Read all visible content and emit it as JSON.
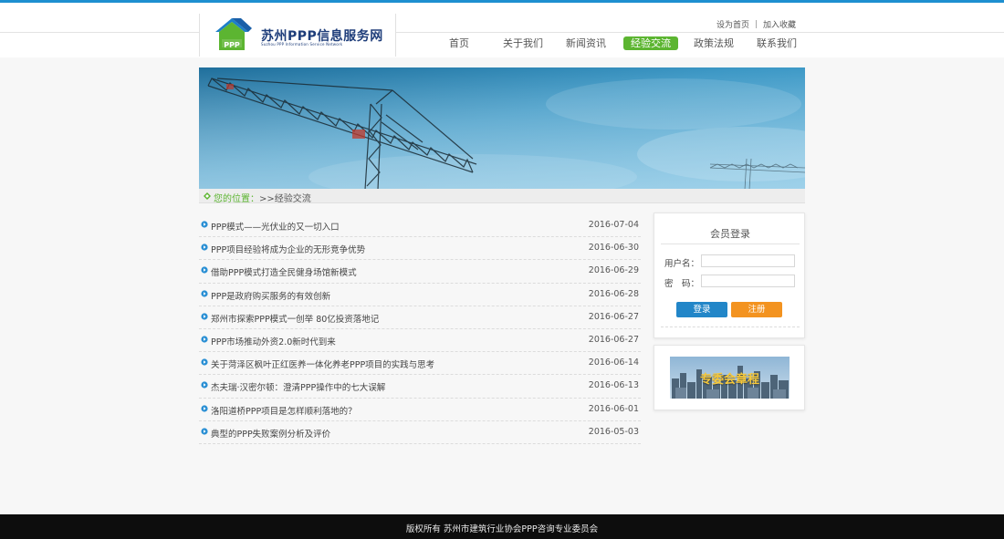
{
  "header": {
    "logo": {
      "title": "苏州PPP信息服务网",
      "subtitle": "Suzhou PPP Information Service Network",
      "badge": "PPP"
    },
    "toplinks": {
      "home": "设为首页",
      "favorite": "加入收藏"
    },
    "nav": [
      {
        "label": "首页",
        "active": false
      },
      {
        "label": "关于我们",
        "active": false
      },
      {
        "label": "新闻资讯",
        "active": false
      },
      {
        "label": "经验交流",
        "active": true
      },
      {
        "label": "政策法规",
        "active": false
      },
      {
        "label": "联系我们",
        "active": false
      }
    ]
  },
  "breadcrumb": {
    "label": "您的位置：",
    "path": ">>经验交流"
  },
  "articles": [
    {
      "title": "PPP模式——光伏业的又一切入口",
      "date": "2016-07-04"
    },
    {
      "title": "PPP项目经验将成为企业的无形竞争优势",
      "date": "2016-06-30"
    },
    {
      "title": "借助PPP模式打造全民健身场馆新模式",
      "date": "2016-06-29"
    },
    {
      "title": "PPP是政府购买服务的有效创新",
      "date": "2016-06-28"
    },
    {
      "title": "郑州市探索PPP模式一创举 80亿投资落地记",
      "date": "2016-06-27"
    },
    {
      "title": "PPP市场推动外资2.0新时代到来",
      "date": "2016-06-27"
    },
    {
      "title": "关于菏泽区枫叶正红医养一体化养老PPP项目的实践与思考",
      "date": "2016-06-14"
    },
    {
      "title": "杰夫瑞·汉密尔顿：澄清PPP操作中的七大误解",
      "date": "2016-06-13"
    },
    {
      "title": "洛阳道桥PPP项目是怎样顺利落地的？",
      "date": "2016-06-01"
    },
    {
      "title": "典型的PPP失败案例分析及评价",
      "date": "2016-05-03"
    }
  ],
  "login": {
    "title": "会员登录",
    "username_label": "用户名：",
    "password_label": "密　码：",
    "username_value": "",
    "password_value": "",
    "login_button": "登录",
    "register_button": "注册"
  },
  "charter": {
    "label": "专委会章程"
  },
  "footer": {
    "text": "版权所有 苏州市建筑行业协会PPP咨询专业委员会"
  },
  "colors": {
    "accent_blue": "#1e8fd0",
    "nav_active": "#5cb531",
    "login_button": "#2286c8",
    "register_button": "#f39320",
    "footer_bg": "#0d0d0d"
  }
}
